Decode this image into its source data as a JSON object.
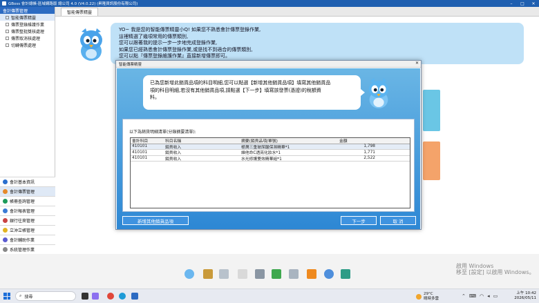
{
  "app": {
    "title": "GBoss 會計總帳-區域網路版 總公司 4.0 (V4.0.22) (昇隆資訊股份有限公司)"
  },
  "sidebar": {
    "header": "會計傳票管理",
    "items": [
      {
        "label": "智能傳票精靈"
      },
      {
        "label": "傳票登錄維護作業"
      },
      {
        "label": "傳票整批獎核處理"
      },
      {
        "label": "傳票取消核處理"
      },
      {
        "label": "切轉傳票處理"
      }
    ],
    "categories": [
      {
        "label": "會計基本資訊",
        "color": "#2a6fce"
      },
      {
        "label": "會計傳票管理",
        "color": "#e58a2b"
      },
      {
        "label": "帳冊查詢管理",
        "color": "#1d9a5a"
      },
      {
        "label": "會計報表管理",
        "color": "#3a7bd5"
      },
      {
        "label": "銀行往來管理",
        "color": "#c94343"
      },
      {
        "label": "立沖立帳管理",
        "color": "#e2b321"
      },
      {
        "label": "會計輔助作業",
        "color": "#5b5bd0"
      },
      {
        "label": "系統管理作業",
        "color": "#888888"
      }
    ]
  },
  "main": {
    "tab": "智能傳票精靈",
    "intro": [
      "YO~ 我是您的智能傳票精靈小Q! 如果您不熟悉會計傳票登錄作業,",
      "這裡精選了幾項常用的傳票類別,",
      "您可以跟著我的提示一步一步地完成登錄作業,",
      "如果您已經熟悉會計傳票登錄作業,或是找不到適合的傳票類別,",
      "您可以點『傳票登錄維護作業』直接新增傳票即可。"
    ]
  },
  "dialog": {
    "title": "智能傳票精靈",
    "close": "✕",
    "bubble": [
      "已為您新增此銷貨品項的科目明細,您可以點選【新增其他銷貨品項】填寫其他銷貨品",
      "項的科目明細,若沒有其他銷貨品項,請點選【下一步】填寫該發票(憑證)的稅額資",
      "料。"
    ],
    "list_caption": "以下為銷貨明細清單(分錄摘要清單):",
    "columns": [
      "會計科目",
      "科目名稱",
      "摘要(銷貨品項/單號)",
      "金額"
    ],
    "rows": [
      {
        "code": "410101",
        "name": "銷貨收入",
        "summary": "極潤三重玻尿酸保濕精華*1",
        "amount": "1,798"
      },
      {
        "code": "410101",
        "name": "銷貨收入",
        "summary": "維他命C透亮化妝水*1",
        "amount": "1,771"
      },
      {
        "code": "410101",
        "name": "銷貨收入",
        "summary": "水光修護雙效精華組*1",
        "amount": "2,522"
      }
    ],
    "buttons": {
      "add": "新增其他銷貨品項",
      "next": "下一步",
      "cancel": "取 消"
    }
  },
  "watermark": [
    "啟用 Windows",
    "移至 [設定] 以啟用 Windows。"
  ],
  "taskbar": {
    "search": "搜尋",
    "weather_temp": "29°C",
    "weather_desc": "晴時多雲",
    "time": "上午 10:42",
    "date": "2026/05/11"
  }
}
